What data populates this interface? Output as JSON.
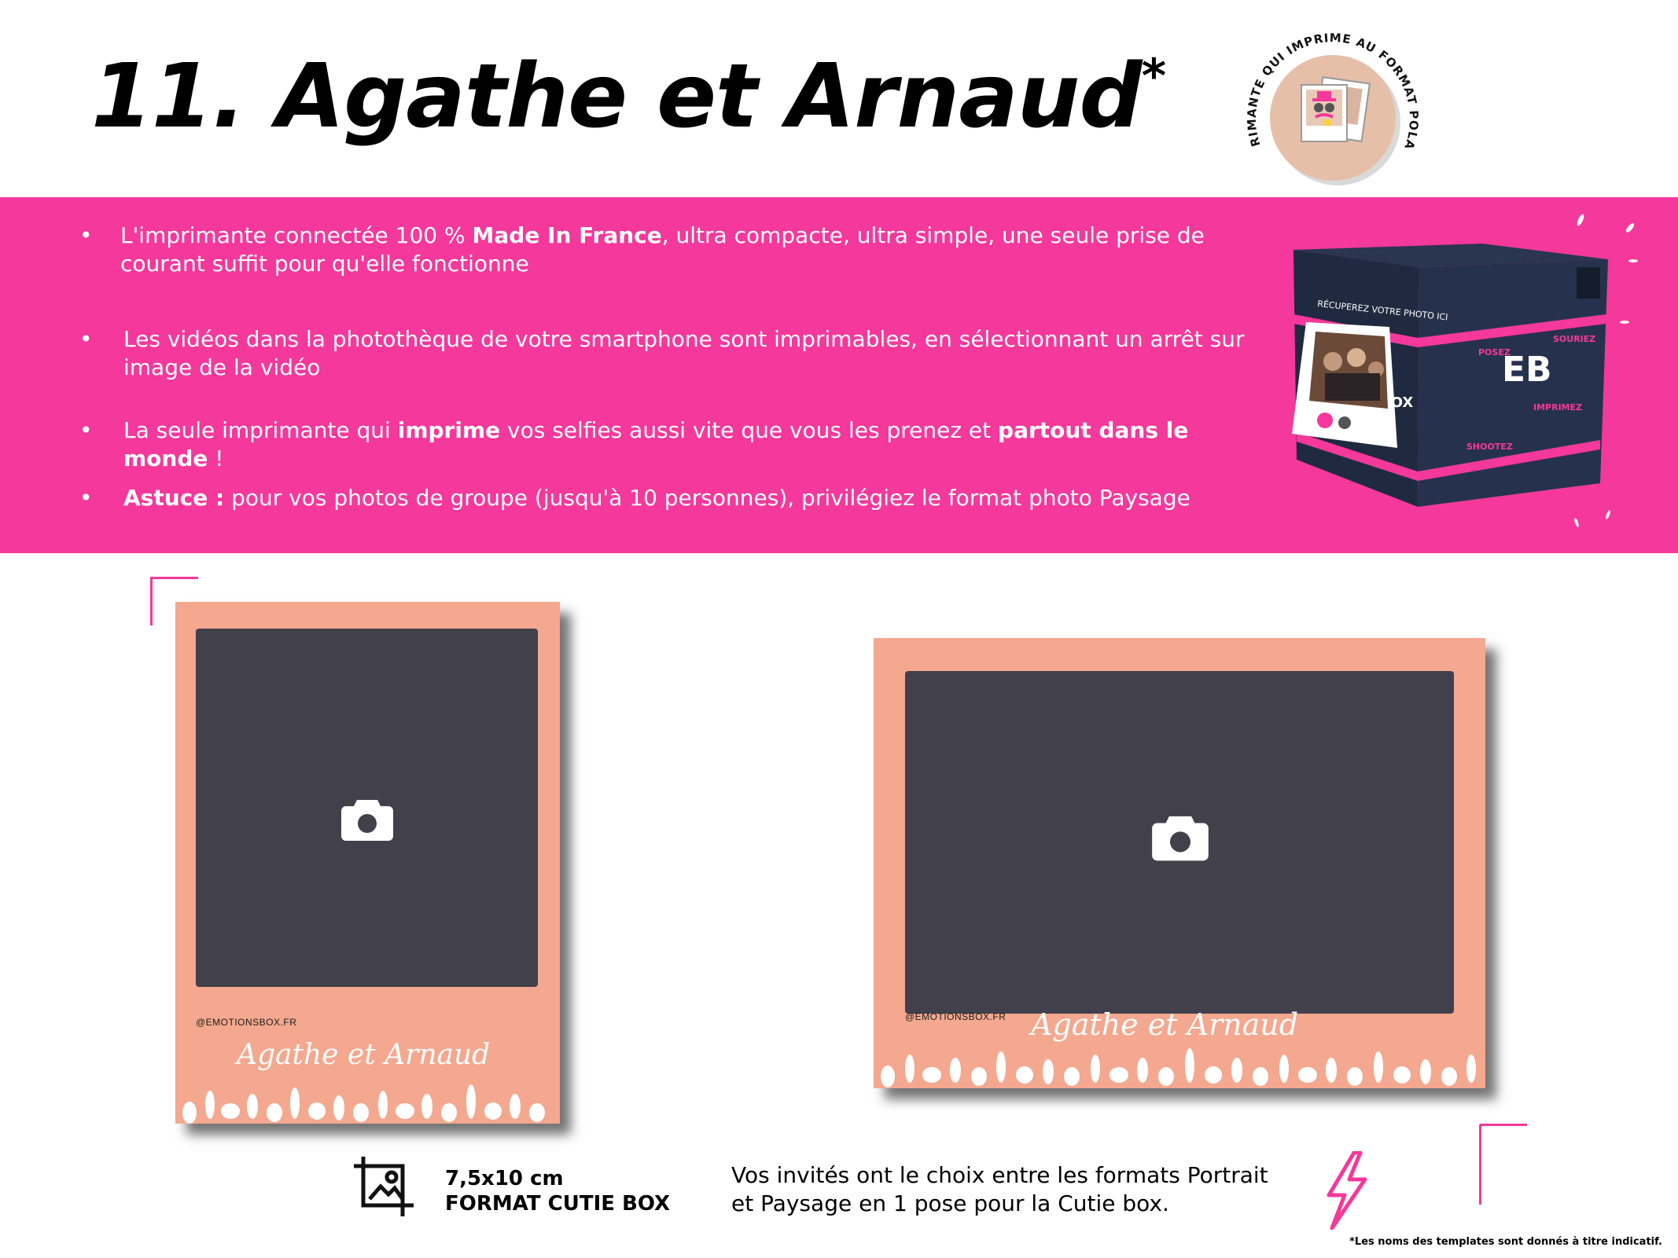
{
  "header": {
    "number": "11.",
    "title": "Agathe et Arnaud",
    "asterisk": "*"
  },
  "badge": {
    "ring_text": "L'IMPRIMANTE QUI IMPRIME AU FORMAT POLAROÏD",
    "ring_color": "#e6bfa8"
  },
  "features": {
    "b1_pre": "L'imprimante connectée 100 % ",
    "b1_bold": "Made In France",
    "b1_post": ", ultra compacte, ultra simple, une seule prise de courant suffit pour qu'elle fonctionne",
    "b2": "Les vidéos dans la photothèque de votre smartphone sont imprimables, en sélectionnant un arrêt sur image de la vidéo",
    "b3_pre": "La seule imprimante qui ",
    "b3_bold1": "imprime",
    "b3_mid": " vos selfies aussi vite que vous les prenez et ",
    "b3_bold2": "partout dans le monde",
    "b3_post": " !",
    "b4_bold": "Astuce :",
    "b4_post": " pour vos photos de groupe (jusqu'à 10 personnes), privilégiez le format photo Paysage",
    "bullet": "•"
  },
  "printer": {
    "panel_text": "RÉCUPEREZ VOTRE PHOTO ICI",
    "logo": "EB",
    "side_word": "BOX",
    "stickers": [
      "POSEZ",
      "SOURIEZ",
      "SHOOTEZ",
      "IMPRIMEZ"
    ]
  },
  "templates": {
    "portrait": {
      "handle": "@EMOTIONSBOX.FR",
      "name": "Agathe et Arnaud"
    },
    "landscape": {
      "handle": "@EMOTIONSBOX.FR",
      "name": "Agathe et Arnaud"
    }
  },
  "footer": {
    "size": "7,5x10 cm",
    "format": "FORMAT CUTIE BOX",
    "choice_text": "Vos invités ont le choix entre les formats Portrait et Paysage en 1 pose pour la Cutie box.",
    "note": "*Les noms des templates sont donnés à titre indicatif."
  },
  "colors": {
    "accent_pink": "#f5389b",
    "frame_peach": "#f4a88f",
    "photo_slot": "#41404b"
  }
}
